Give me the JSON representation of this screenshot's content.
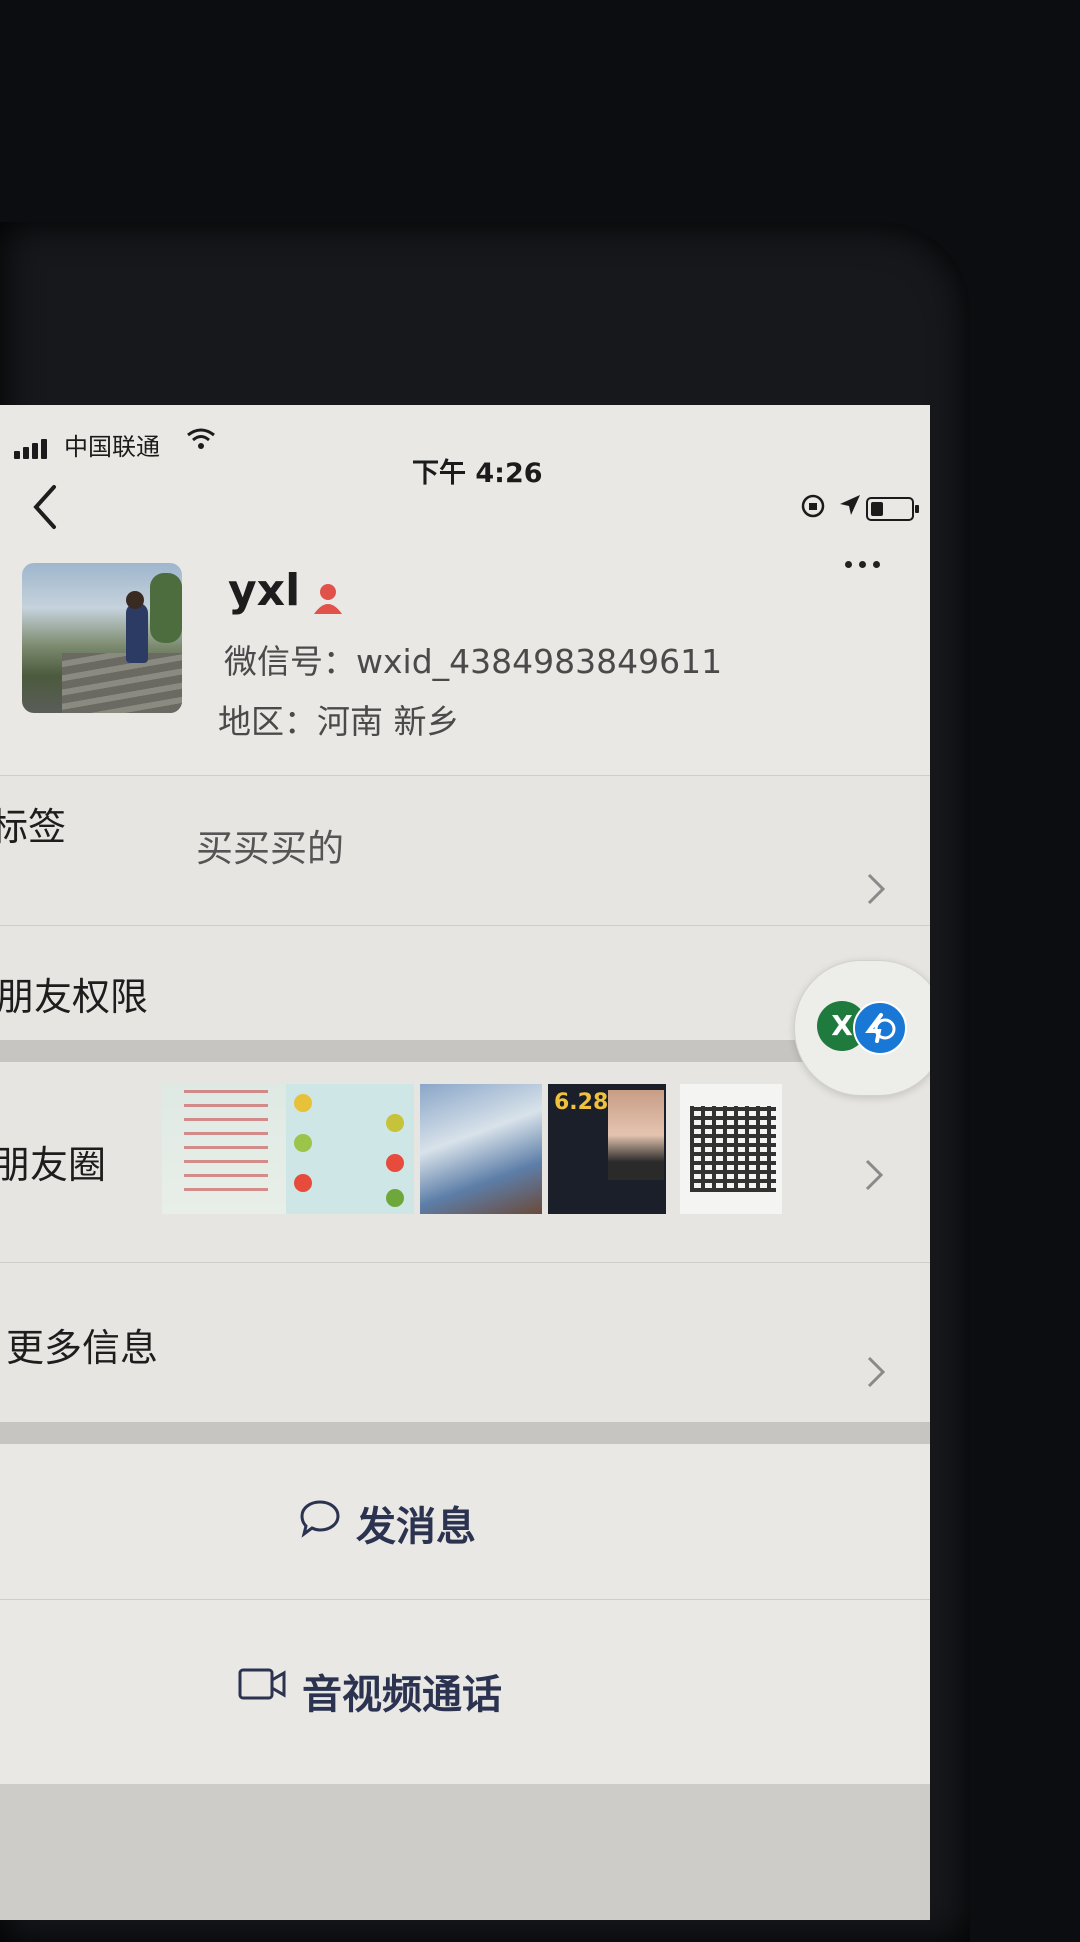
{
  "status_bar": {
    "carrier": "中国联通",
    "time": "下午 4:26",
    "battery_level": 0.25
  },
  "nav": {
    "back_icon": "chevron-left-icon",
    "more_icon": "ellipsis-icon"
  },
  "profile": {
    "nickname": "yxl",
    "gender_icon": "female-icon",
    "wxid": "微信号：wxid_4384983849611",
    "region": "地区：河南 新乡"
  },
  "rows": {
    "tags_label": "标签",
    "tags_value": "买买买的",
    "moments_permission_label": "朋友权限",
    "moments_label": "朋友圈",
    "more_info_label": "更多信息"
  },
  "moments_thumbnails": [
    {
      "name": "moments-thumb-promo-flyer"
    },
    {
      "name": "moments-thumb-fruit-menu"
    },
    {
      "name": "moments-thumb-product-photo"
    },
    {
      "name": "moments-thumb-poster"
    },
    {
      "name": "moments-thumb-qr-code"
    }
  ],
  "actions": {
    "send_message": "发消息",
    "video_call": "音视频通话"
  },
  "floating_button": {
    "badge_text": "X"
  },
  "colors": {
    "accent_text": "#2b3350",
    "gender_icon": "#e0524a",
    "float_green": "#1f7a3e",
    "float_blue": "#1978d6"
  }
}
